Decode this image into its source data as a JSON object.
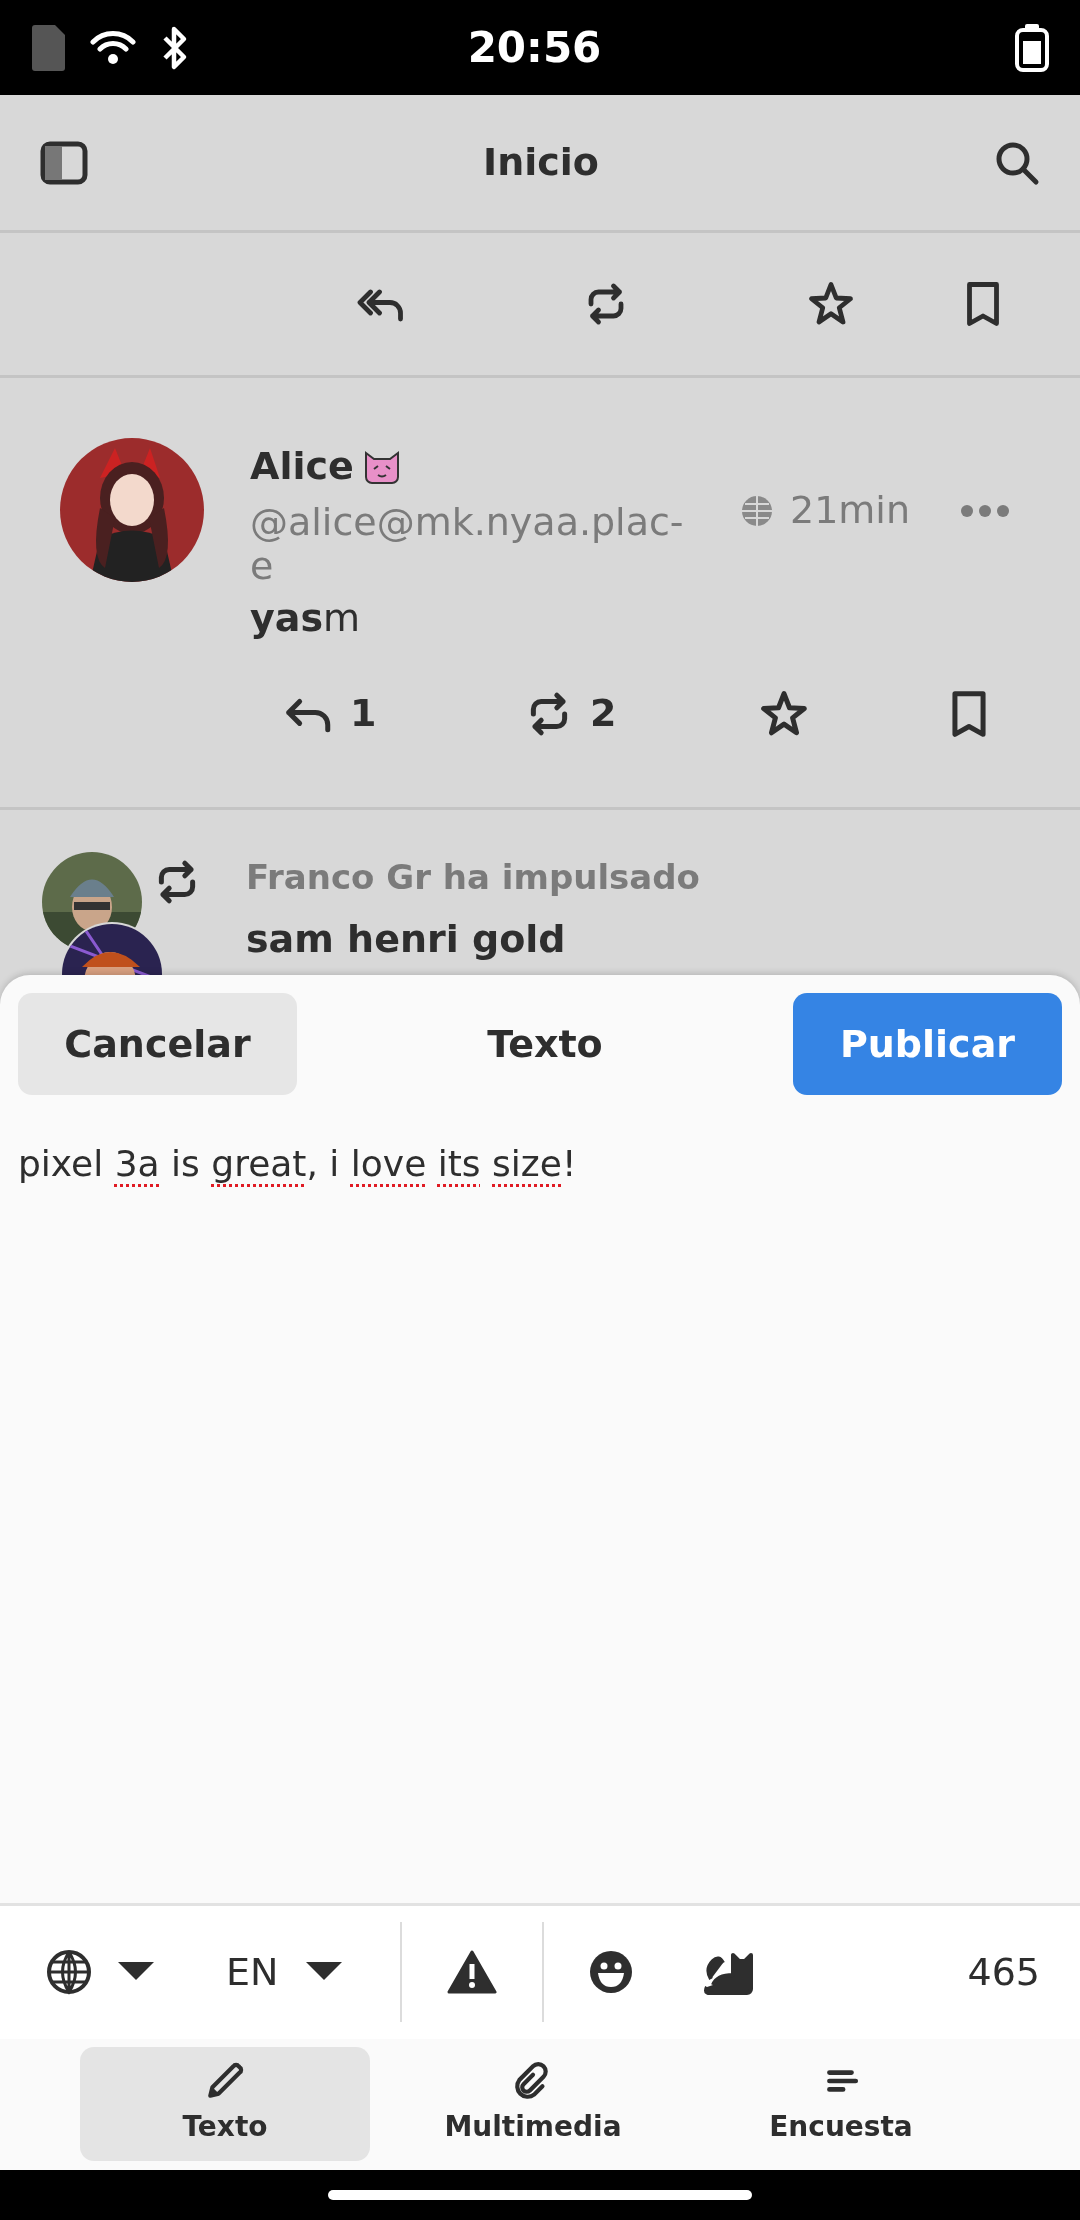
{
  "status_bar": {
    "time": "20:56"
  },
  "header": {
    "title": "Inicio"
  },
  "post": {
    "display_name": "Alice",
    "handle_lines": [
      "@alice@mk.nyaa.plac-",
      "e"
    ],
    "time": "21min",
    "content": "**yas**m",
    "replies": "1",
    "boosts": "2"
  },
  "boost": {
    "text": "Franco Gr ha impulsado",
    "author": "sam henri gold"
  },
  "composer": {
    "cancel": "Cancelar",
    "title": "Texto",
    "publish": "Publicar",
    "text_segments": [
      {
        "text": "pixel ",
        "misspelled": false
      },
      {
        "text": "3a",
        "misspelled": true
      },
      {
        "text": " is ",
        "misspelled": false
      },
      {
        "text": "great",
        "misspelled": true
      },
      {
        "text": ", i ",
        "misspelled": false
      },
      {
        "text": "love",
        "misspelled": true,
        "space_after": true
      },
      {
        "text": "its",
        "misspelled": true,
        "space_after": true
      },
      {
        "text": "size",
        "misspelled": true
      },
      {
        "text": "!",
        "misspelled": false
      }
    ],
    "language": "EN",
    "remaining": "465",
    "tabs": [
      {
        "label": "Texto",
        "selected": true
      },
      {
        "label": "Multimedia",
        "selected": false
      },
      {
        "label": "Encuesta",
        "selected": false
      }
    ]
  }
}
